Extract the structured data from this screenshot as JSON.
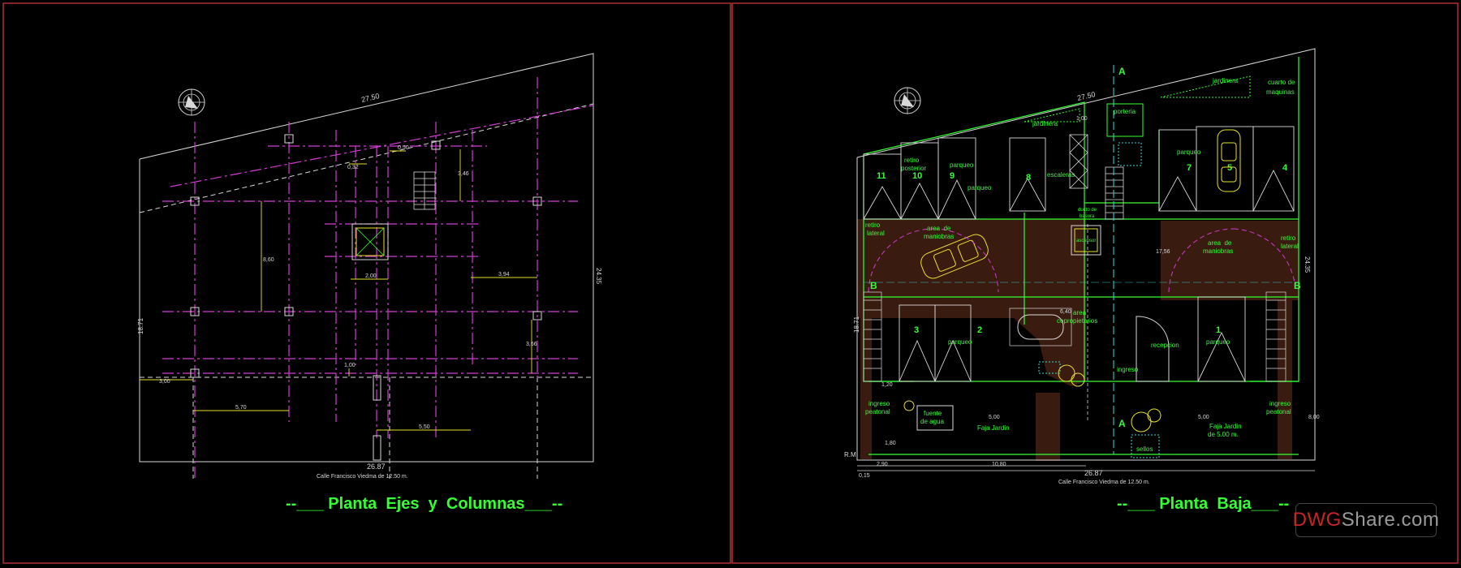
{
  "colors": {
    "frame": "#b03035",
    "cyan": "#3dd8d8",
    "magenta": "#d23cd2",
    "green": "#33ff33",
    "yellow": "#e8e030",
    "white": "#d8d8d8",
    "floor": "#3a1b10"
  },
  "watermark": {
    "part1": "DWG",
    "part2": "Share.com"
  },
  "left": {
    "title": "--___ Planta  Ejes  y  Columnas___--",
    "street": "Calle Francisco Viedma de 12.50 m.",
    "dims": {
      "top": "27.50",
      "bottom": "26.87",
      "right": "24.35",
      "left": "18.71",
      "d1": "5,70",
      "d2": "5,50",
      "d3": "2,00",
      "d4": "3,94",
      "d5": "8,60",
      "d6": "3,46",
      "d7": "3,66",
      "d8": "1,00",
      "d9": "0,50",
      "d10": "3,00",
      "d11": "0,32"
    }
  },
  "right": {
    "title": "--___ Planta  Baja___--",
    "street": "Calle Francisco Viedma de 12.50 m.",
    "dims": {
      "top": "27.50",
      "bottom": "26.87",
      "right": "24.35",
      "left": "18.71",
      "rm": "R.M",
      "dim_a": "0,15",
      "dim_b": "2,90",
      "dim_c": "10,80",
      "dim_d": "5,00",
      "dim_e": "5,00",
      "dim_f": "17,56",
      "dim_g": "6,40",
      "dim_h": "1,00",
      "dim_i": "8,00",
      "dim_j": "1,80",
      "dim_k": "1,20"
    },
    "labels": {
      "jardinera1": "jardinera",
      "jardinera2": "jardinera",
      "porteria": "porteria",
      "cuarto": "cuarto de",
      "maquinas": "maquinas",
      "retiro_post": "retiro",
      "retiro_post2": "posterior",
      "parqueo_a": "parqueo",
      "parqueo_b": "parqueo",
      "parqueo_c": "parqueo",
      "parqueo_d": "parqueo",
      "parqueo_e": "parqueo",
      "escaleras": "escaleras",
      "basura": "ducto de",
      "basura2": "basura",
      "retiro_lat_l": "retiro",
      "retiro_lat_l2": "lateral",
      "retiro_lat_r": "retiro",
      "retiro_lat_r2": "lateral",
      "area_man_l": "area  de",
      "area_man_l2": "maniobras",
      "area_man_r": "area  de",
      "area_man_r2": "maniobras",
      "ascensor": "ascensor",
      "area_cop": "area",
      "area_cop2": "copropietarios",
      "recepcion": "recepcion",
      "ingreso": "ingreso",
      "ingreso_peat_l": "ingreso",
      "ingreso_peat_l2": "peatonal",
      "ingreso_peat_r": "ingreso",
      "ingreso_peat_r2": "peatonal",
      "fuente": "fuente",
      "fuente2": "de agua",
      "faja_l": "Faja Jardin",
      "faja_r": "Faja Jardin",
      "faja_r2": "de 5.00 m.",
      "sellos": "sellos",
      "sec_a_top": "A",
      "sec_a_bot": "A",
      "sec_b_l": "B",
      "sec_b_r": "B"
    },
    "stalls": [
      "11",
      "10",
      "9",
      "8",
      "7",
      "5",
      "4",
      "3",
      "2",
      "1"
    ]
  }
}
